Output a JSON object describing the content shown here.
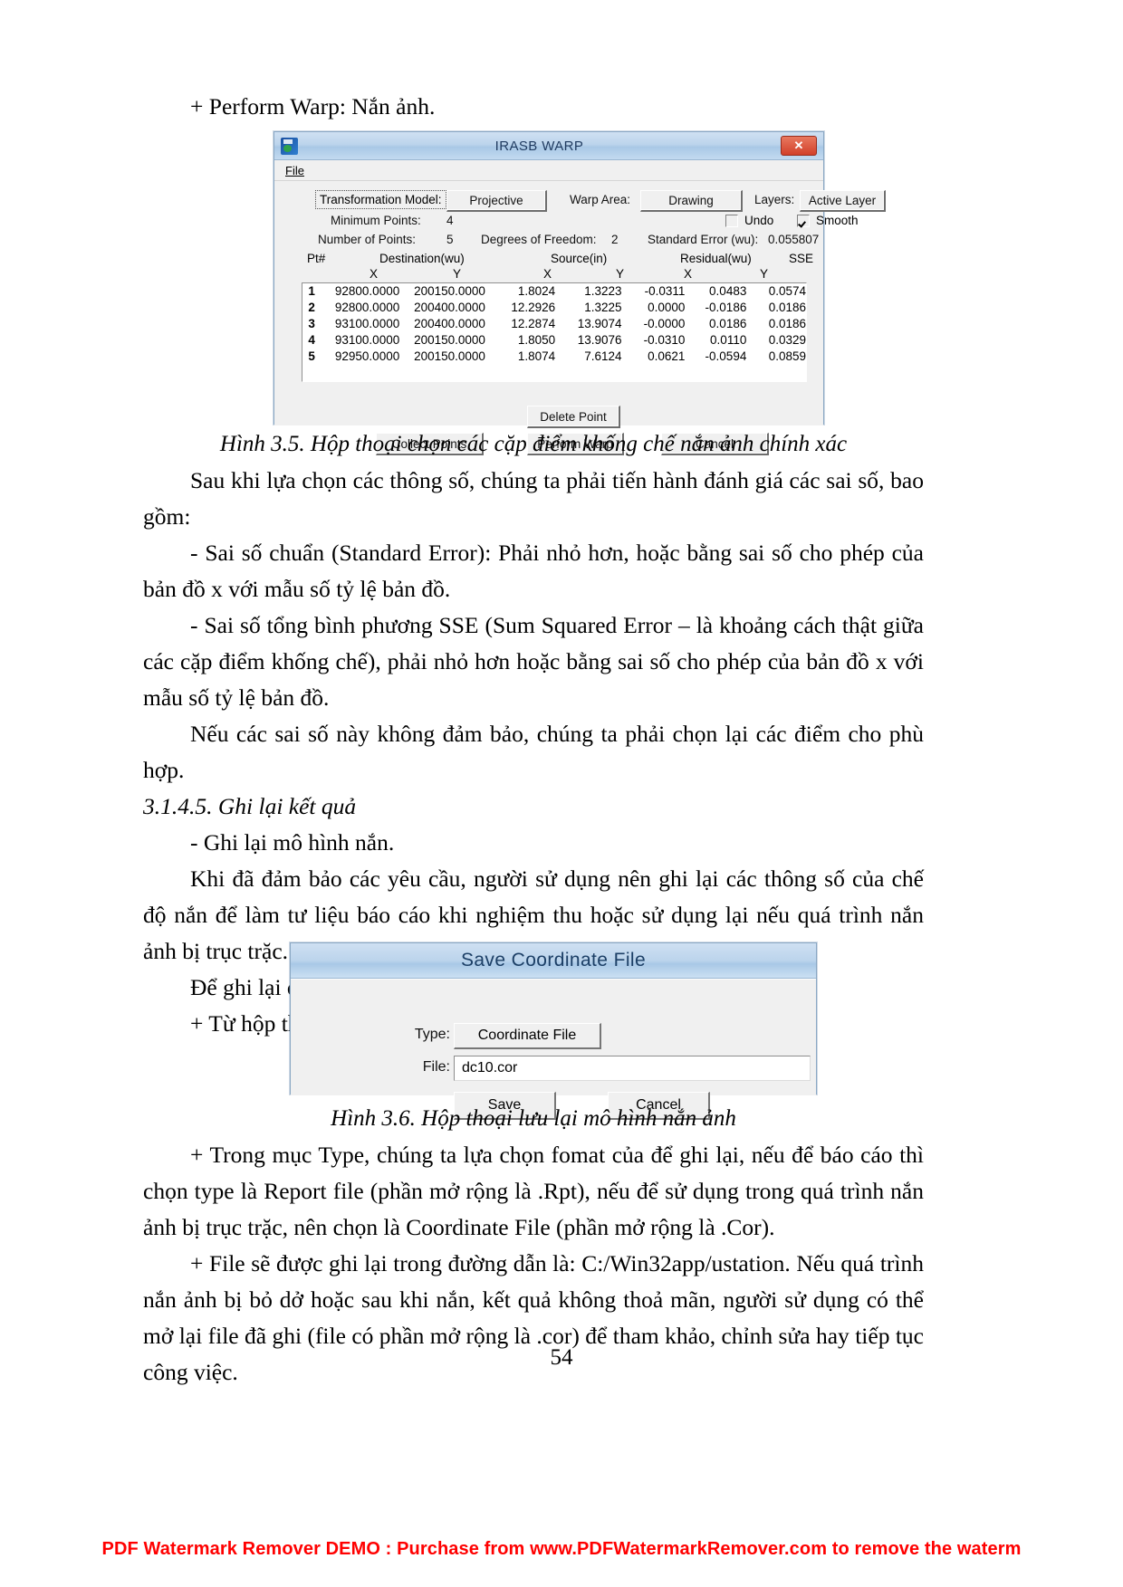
{
  "document": {
    "page_number": "54",
    "watermark": "PDF Watermark Remover DEMO : Purchase from www.PDFWatermarkRemover.com to remove the waterm",
    "paragraphs": {
      "p1": "+ Perform Warp: Nắn ảnh.",
      "caption1": "Hình 3.5. Hộp thoại chọn các cặp điểm khống chế nắn ảnh chính xác",
      "p2": "Sau khi lựa chọn các thông số, chúng ta phải tiến hành đánh giá các sai số, bao gồm:",
      "p3": "- Sai số chuẩn (Standard Error): Phải nhỏ hơn, hoặc bằng sai số cho phép của bản đồ x với mẫu số tỷ lệ bản đồ.",
      "p4": "- Sai số tổng bình phương SSE (Sum Squared Error – là khoảng cách thật giữa các cặp điểm khống chế), phải nhỏ hơn hoặc bằng sai số cho phép của bản đồ x với mẫu số tỷ lệ bản đồ.",
      "p5": "Nếu các sai số này không đảm bảo, chúng ta phải chọn lại các điểm cho phù hợp.",
      "heading1": "3.1.4.5. Ghi lại kết quả",
      "p6": "- Ghi lại mô hình nắn.",
      "p7": "Khi đã đảm bảo các yêu cầu, người sử dụng nên ghi lại các thông số của chế độ nắn để làm tư liệu báo cáo khi nghiệm thu hoặc sử dụng lại nếu quá trình nắn ảnh bị trục trặc.",
      "p8": "Để ghi lại chúng ta thực hiện như sau:",
      "p9": "+ Từ hộp thoại IrasB Warp, chọn File/Save As, xuất hiện hộp thoại.",
      "caption2": "Hình 3.6. Hộp thoại lưu lại mô hình nắn ảnh",
      "p10": "+ Trong mục Type, chúng ta lựa chọn fomat của để ghi lại, nếu để báo cáo thì chọn type là Report file (phần mở rộng là .Rpt), nếu để sử dụng trong quá trình nắn ảnh bị trục trặc, nên chọn là Coordinate File (phần mở rộng là .Cor).",
      "p11": "+ File sẽ được ghi lại trong đường dẫn là: C:/Win32app/ustation. Nếu quá trình nắn ảnh bị bỏ dở hoặc sau khi nắn, kết quả không thoả mãn, người sử dụng có thể mở lại file đã ghi (file có phần mở rộng là .cor) để tham khảo, chỉnh sửa hay tiếp tục công việc."
    }
  },
  "warp_dialog": {
    "title": "IRASB WARP",
    "menu": {
      "file": "File"
    },
    "close_label": "✕",
    "transformation_model_label": "Transformation Model:",
    "transformation_model_value": "Projective",
    "warp_area_label": "Warp Area:",
    "warp_area_value": "Drawing",
    "layers_label": "Layers:",
    "layers_value": "Active Layer",
    "minimum_points_label": "Minimum Points:",
    "minimum_points_value": "4",
    "number_of_points_label": "Number of Points:",
    "number_of_points_value": "5",
    "degrees_of_freedom_label": "Degrees of Freedom:",
    "degrees_of_freedom_value": "2",
    "standard_error_label": "Standard Error (wu):",
    "standard_error_value": "0.055807",
    "undo_label": "Undo",
    "undo_checked": false,
    "smooth_label": "Smooth",
    "smooth_checked": true,
    "table": {
      "headers": {
        "pt": "Pt#",
        "destination": "Destination(wu)",
        "source": "Source(in)",
        "residual": "Residual(wu)",
        "sse": "SSE",
        "dest_x": "X",
        "dest_y": "Y",
        "src_x": "X",
        "src_y": "Y",
        "res_x": "X",
        "res_y": "Y"
      },
      "rows": [
        {
          "pt": "1",
          "dx": "92800.0000",
          "dy": "200150.0000",
          "sx": "1.8024",
          "sy": "1.3223",
          "rx": "-0.0311",
          "ry": "0.0483",
          "sse": "0.0574"
        },
        {
          "pt": "2",
          "dx": "92800.0000",
          "dy": "200400.0000",
          "sx": "12.2926",
          "sy": "1.3225",
          "rx": "0.0000",
          "ry": "-0.0186",
          "sse": "0.0186"
        },
        {
          "pt": "3",
          "dx": "93100.0000",
          "dy": "200400.0000",
          "sx": "12.2874",
          "sy": "13.9074",
          "rx": "-0.0000",
          "ry": "0.0186",
          "sse": "0.0186"
        },
        {
          "pt": "4",
          "dx": "93100.0000",
          "dy": "200150.0000",
          "sx": "1.8050",
          "sy": "13.9076",
          "rx": "-0.0310",
          "ry": "0.0110",
          "sse": "0.0329"
        },
        {
          "pt": "5",
          "dx": "92950.0000",
          "dy": "200150.0000",
          "sx": "1.8074",
          "sy": "7.6124",
          "rx": "0.0621",
          "ry": "-0.0594",
          "sse": "0.0859"
        }
      ]
    },
    "buttons": {
      "delete_point": "Delete Point",
      "collect_points": "Collect Points",
      "perform_warp": "Perform Warp",
      "cancel": "Cancel"
    }
  },
  "save_dialog": {
    "title": "Save Coordinate File",
    "type_label": "Type:",
    "type_value": "Coordinate File",
    "file_label": "File:",
    "file_value": "dc10.cor",
    "save_button": "Save",
    "cancel_button": "Cancel"
  }
}
